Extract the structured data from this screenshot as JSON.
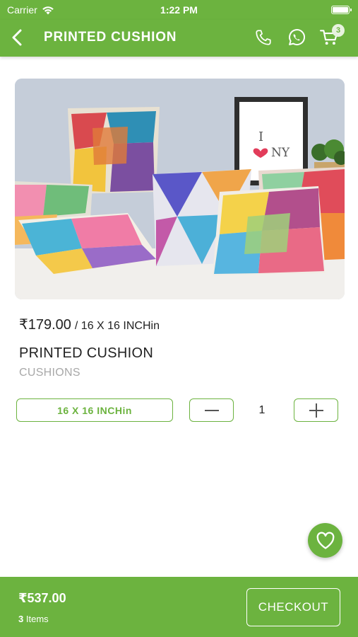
{
  "status_bar": {
    "carrier": "Carrier",
    "time": "1:22 PM"
  },
  "header": {
    "title": "PRINTED CUSHION",
    "cart_count": "3",
    "icons": [
      "back-chevron-icon",
      "phone-icon",
      "whatsapp-icon",
      "cart-icon"
    ]
  },
  "product": {
    "image_alt": "Colorful geometric printed cushions on a sofa",
    "frame_text": [
      "I",
      "NY"
    ],
    "price": "₹179.00",
    "price_unit": "/ 16 X 16 INCHin",
    "name": "PRINTED CUSHION",
    "category": "CUSHIONS",
    "variant": "16 X 16 INCHin",
    "quantity": "1"
  },
  "footer": {
    "total": "₹537.00",
    "item_count": "3",
    "items_label": "Items",
    "checkout_label": "CHECKOUT"
  },
  "colors": {
    "brand_green": "#6cb33f",
    "text_dark": "#222222",
    "text_muted": "#a8a8a8",
    "background": "#ffffff"
  }
}
